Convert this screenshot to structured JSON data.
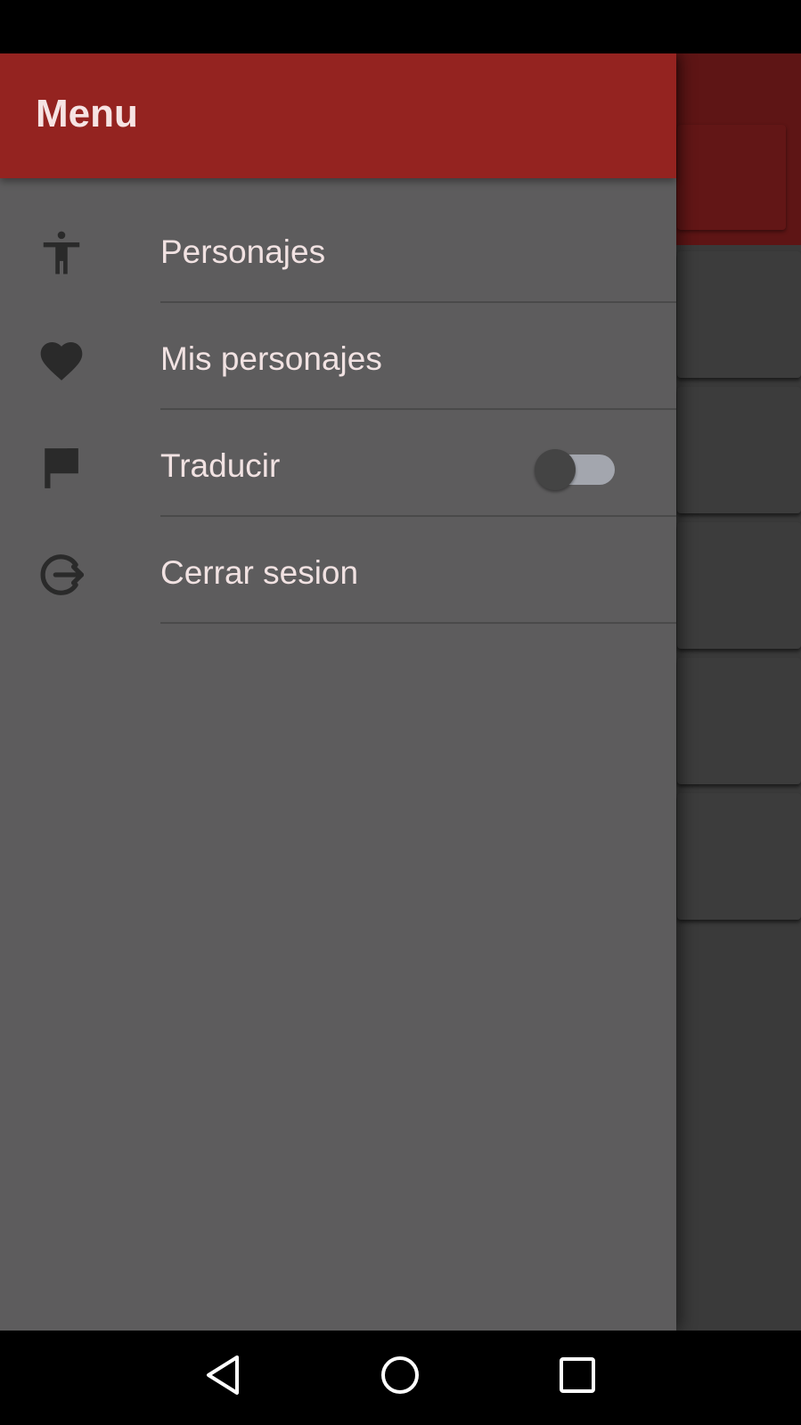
{
  "drawer": {
    "title": "Menu",
    "items": [
      {
        "label": "Personajes",
        "icon": "accessibility-icon"
      },
      {
        "label": "Mis personajes",
        "icon": "heart-icon"
      },
      {
        "label": "Traducir",
        "icon": "flag-icon",
        "toggle": {
          "on": false
        }
      },
      {
        "label": "Cerrar sesion",
        "icon": "logout-icon"
      }
    ]
  },
  "navigation_bar": {
    "buttons": [
      "back-icon",
      "home-icon",
      "recents-icon"
    ]
  },
  "colors": {
    "header": "#942320",
    "drawer_bg": "#5d5c5d",
    "text": "#f1e2e2",
    "icon": "#2a2a2a",
    "toggle_track": "#a3a6ae",
    "toggle_thumb": "#444444"
  }
}
